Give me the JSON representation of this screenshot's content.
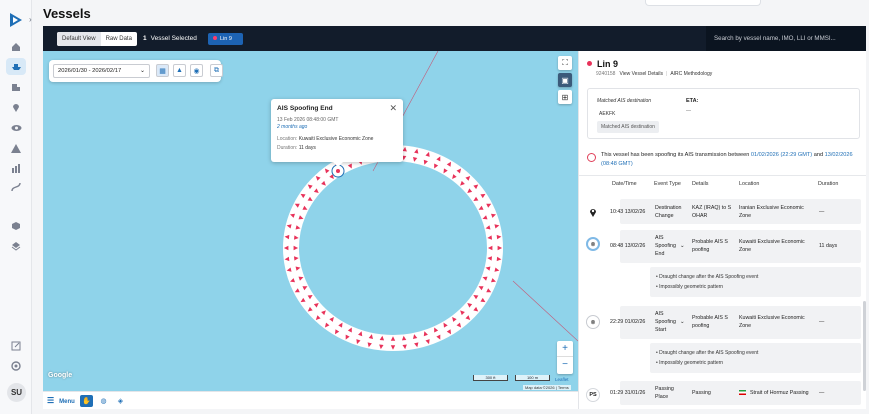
{
  "page": {
    "title": "Vessels"
  },
  "rail": {
    "nav": [
      "home-icon",
      "ship-icon",
      "building-icon",
      "location-pin-icon",
      "eye-icon",
      "alert-icon",
      "chart-icon",
      "route-icon",
      "cube-icon",
      "layers-icon"
    ],
    "bottom": [
      "export-icon",
      "settings-icon"
    ],
    "avatar": "SU"
  },
  "toolbar": {
    "view_default": "Default View",
    "view_raw": "Raw Data",
    "selected_count": "1",
    "selected_label": "Vessel Selected",
    "vessel_chip": "Lin 9",
    "search_placeholder": "Search by vessel name, IMO, LLI or MMSI..."
  },
  "map": {
    "date_range": "2026/01/30 - 2026/02/17",
    "popup": {
      "title": "AIS Spoofing End",
      "datetime": "13 Feb 2026 08:48:00 GMT",
      "ago": "2 months ago",
      "location_label": "Location:",
      "location": "Kuwaiti Exclusive Economic Zone",
      "duration_label": "Duration:",
      "duration": "11 days"
    },
    "zoom_in": "+",
    "zoom_out": "−",
    "google": "Google",
    "scale_km": "300 ft",
    "scale_m": "100 m",
    "attribution": "Map data ©2026",
    "terms": "Terms",
    "leaflet": "Leaflet",
    "menu": "Menu"
  },
  "detail": {
    "vessel_name": "Lin 9",
    "imo": "9240158",
    "vessel_details_link": "View Vessel Details",
    "methodology_link": "AIRC Methodology",
    "matched_dest_label": "Matched AIS destination",
    "matched_dest_value": "AEKFK",
    "matched_dest_tag": "Matched AIS destination",
    "eta_label": "ETA:",
    "eta_value": "—",
    "alert_prefix": "This vessel has been spoofing its AIS transmission between",
    "alert_start": "01/02/2026 (22:29 GMT)",
    "alert_and": "and",
    "alert_end": "13/02/2026 (08:48 GMT)",
    "columns": [
      "Date/Time",
      "Event Type",
      "Details",
      "Location",
      "Duration"
    ],
    "events": [
      {
        "time": "10:43 13/02/26",
        "type": "Destination Change",
        "details": "KAZ (IRAQ) to S OHAR",
        "location": "Iranian Exclusive Economic Zone",
        "duration": "—",
        "icon": "location-pin-icon"
      },
      {
        "time": "08:48 13/02/26",
        "type": "AIS Spoofing End",
        "details": "Probable AIS S poofing",
        "location": "Kuwaiti Exclusive Economic Zone",
        "duration": "11 days",
        "icon": "spoofing-icon",
        "notes": [
          "Draught change after the AIS Spoofing event",
          "Impossibly geometric pattern"
        ]
      },
      {
        "time": "22:29 01/02/26",
        "type": "AIS Spoofing Start",
        "details": "Probable AIS S poofing",
        "location": "Kuwaiti Exclusive Economic Zone",
        "duration": "—",
        "icon": "spoofing-icon",
        "notes": [
          "Draught change after the AIS Spoofing event",
          "Impossibly geometric pattern"
        ]
      },
      {
        "time": "01:29 31/01/26",
        "type": "Passing Place",
        "details": "Passing",
        "location": "Strait of Hormuz Passing",
        "duration": "—",
        "icon": "ps-badge",
        "badge": "PS"
      }
    ]
  },
  "colors": {
    "accent": "#1f6fb6",
    "toolbar": "#121c2b",
    "sea": "#8fd3ea",
    "track": "#e8325a"
  }
}
